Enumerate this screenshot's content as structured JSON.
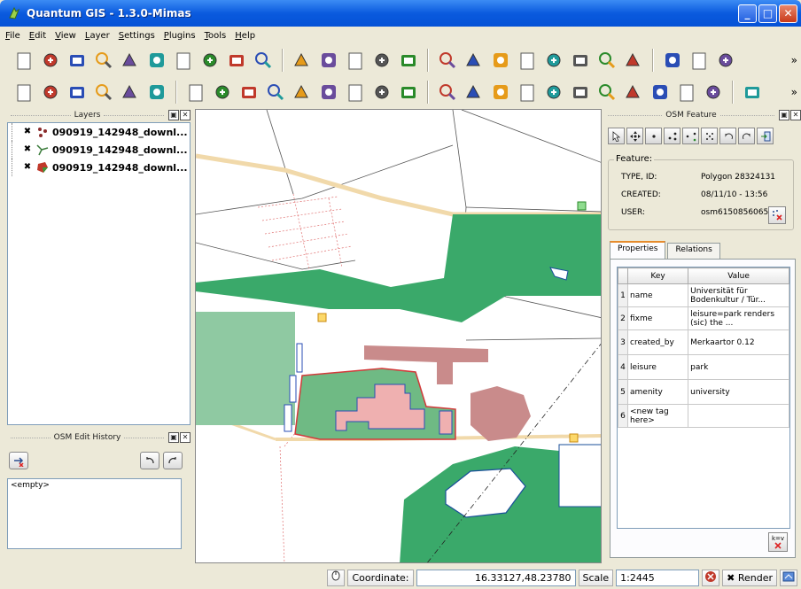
{
  "window": {
    "title": "Quantum GIS - 1.3.0-Mimas"
  },
  "menu": [
    "File",
    "Edit",
    "View",
    "Layer",
    "Settings",
    "Plugins",
    "Tools",
    "Help"
  ],
  "toolbar1_icons": [
    "new-project-icon",
    "open-project-icon",
    "save-project-icon",
    "save-as-icon",
    "print-icon",
    "add-vector-layer-icon",
    "remove-layer-icon",
    "new-layer-icon",
    "add-layer-icon",
    "add-wms-icon",
    "digitize-icon",
    "delete-feature-icon",
    "edit-icon",
    "show-all-icon",
    "hide-icon",
    "identify-icon",
    "select-icon",
    "attribute-table-icon",
    "measure-icon",
    "map-tips-icon",
    "speech-bubble-icon",
    "home-icon",
    "bookmark-icon",
    "pencil-icon",
    "move-icon",
    "pan-icon"
  ],
  "toolbar2_icons": [
    "add-group-icon",
    "identify-layer-icon",
    "zoom-layer-icon",
    "refresh-layer-icon",
    "layer-prop-icon",
    "hide-layer-icon",
    "pan-hand-icon",
    "zoom-in-icon",
    "zoom-out-icon",
    "zoom-full-icon",
    "zoom-selection-icon",
    "zoom-layer-extent-icon",
    "zoom-last-icon",
    "zoom-next-icon",
    "refresh-icon",
    "undo-icon",
    "redo-icon",
    "add-ring-icon",
    "add-island-icon",
    "delete-ring-icon",
    "delete-part-icon",
    "reshape-icon",
    "split-icon",
    "merge-icon",
    "simplify-icon",
    "node-tool-icon",
    "label-icon"
  ],
  "layers_panel": {
    "title": "Layers",
    "layers": [
      {
        "name": "090919_142948_downl...",
        "icon": "point-layer-icon"
      },
      {
        "name": "090919_142948_downl...",
        "icon": "line-layer-icon"
      },
      {
        "name": "090919_142948_downl...",
        "icon": "polygon-layer-icon"
      }
    ]
  },
  "history_panel": {
    "title": "OSM Edit History",
    "empty_label": "<empty>"
  },
  "osm_panel": {
    "title": "OSM Feature",
    "feature_legend": "Feature:",
    "type_label": "TYPE, ID:",
    "type_value": "Polygon 28324131",
    "created_label": "CREATED:",
    "created_value": "08/11/10 - 13:56",
    "user_label": "USER:",
    "user_value": "osm6150856065",
    "tabs": [
      "Properties",
      "Relations"
    ],
    "table_headers": [
      "Key",
      "Value"
    ],
    "rows": [
      {
        "n": "1",
        "key": "name",
        "value": "Universität für Bodenkultur / Tür..."
      },
      {
        "n": "2",
        "key": "fixme",
        "value": "leisure=park renders (sic) the ..."
      },
      {
        "n": "3",
        "key": "created_by",
        "value": "Merkaartor 0.12"
      },
      {
        "n": "4",
        "key": "leisure",
        "value": "park"
      },
      {
        "n": "5",
        "key": "amenity",
        "value": "university"
      },
      {
        "n": "6",
        "key": "<new tag here>",
        "value": ""
      }
    ],
    "kv_label": "k=v"
  },
  "status": {
    "coordinate_label": "Coordinate:",
    "coordinate_value": "16.33127,48.23780",
    "scale_label": "Scale",
    "scale_value": "1:2445",
    "render_label": "Render"
  },
  "colors": {
    "park": "#3aa96a",
    "building": "#c98b8b",
    "selection": "#d23a3a",
    "road": "#f5deb3",
    "accent": "#0a5ade"
  }
}
